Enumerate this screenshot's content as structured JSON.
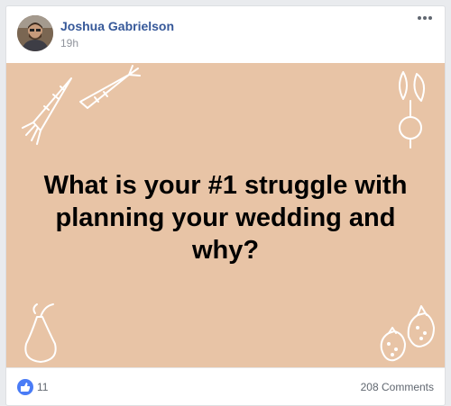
{
  "post": {
    "author": "Joshua Gabrielson",
    "timestamp": "19h",
    "more_icon": "more-horizontal-icon",
    "question": "What is your #1 struggle with planning your wedding and why?",
    "image_background": "#e8c4a6",
    "decorations": [
      "carrot-icon",
      "carrot-icon",
      "beet-icon",
      "pear-icon",
      "strawberry-icon",
      "strawberry-icon"
    ]
  },
  "footer": {
    "like_icon": "thumbs-up-icon",
    "like_count": "11",
    "comments": "208 Comments"
  },
  "colors": {
    "author_link": "#365899",
    "like_blue": "#4a7cf6",
    "muted_text": "#606770"
  }
}
